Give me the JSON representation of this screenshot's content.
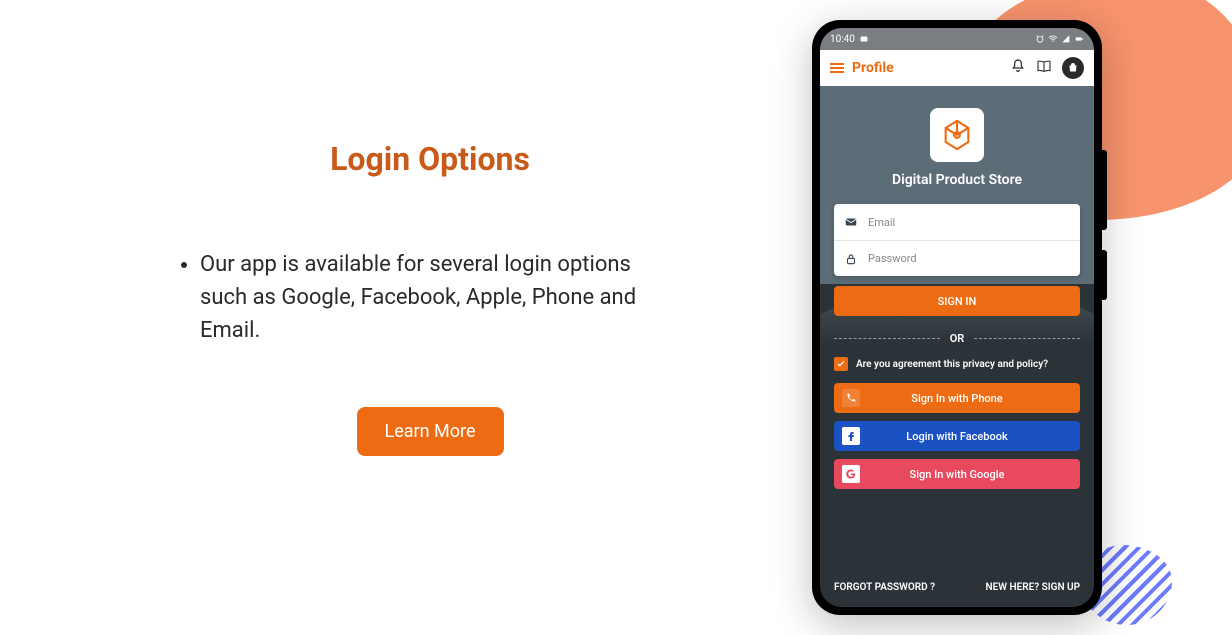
{
  "left_panel": {
    "heading": "Login Options",
    "bullet": "Our app is available for several login options such as Google, Facebook, Apple, Phone and Email.",
    "learn_more": "Learn More"
  },
  "status_bar": {
    "time": "10:40"
  },
  "app_header": {
    "title": "Profile"
  },
  "login": {
    "store_title": "Digital Product Store",
    "email_placeholder": "Email",
    "password_placeholder": "Password",
    "sign_in": "SIGN IN",
    "or": "OR",
    "agreement": "Are you agreement this privacy and policy?",
    "phone_btn": "Sign In with Phone",
    "facebook_btn": "Login with Facebook",
    "google_btn": "Sign In with Google",
    "forgot": "FORGOT PASSWORD ?",
    "signup": "NEW HERE? SIGN UP"
  }
}
